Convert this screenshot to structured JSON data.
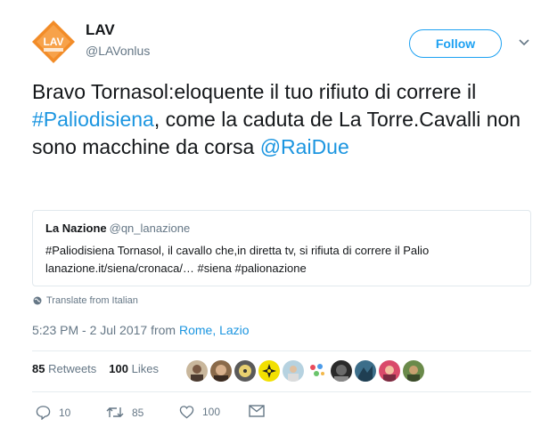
{
  "user": {
    "name": "LAV",
    "handle": "@LAVonlus",
    "logo_text": "LAV"
  },
  "follow_label": "Follow",
  "tweet": {
    "part1": "Bravo Tornasol:eloquente il tuo rifiuto di correre il ",
    "hashtag": "#Paliodisiena",
    "part2": ", come la caduta de La Torre.Cavalli non sono macchine da corsa ",
    "mention": "@RaiDue"
  },
  "quote": {
    "name": "La Nazione",
    "handle": "@qn_lanazione",
    "line1": "#Paliodisiena Tornasol, il cavallo che,in diretta tv, si rifiuta di correre il Palio",
    "line2": "lanazione.it/siena/cronaca/… #siena #palionazione"
  },
  "translate_label": "Translate from Italian",
  "timestamp": "5:23 PM - 2 Jul 2017 from ",
  "location": "Rome, Lazio",
  "stats": {
    "retweets_count": "85",
    "retweets_label": "Retweets",
    "likes_count": "100",
    "likes_label": "Likes"
  },
  "actions": {
    "replies": "10",
    "retweets": "85",
    "likes": "100"
  },
  "colors": {
    "link": "#1b95e0",
    "follow": "#1da1f2",
    "logo": "#f28c28"
  }
}
